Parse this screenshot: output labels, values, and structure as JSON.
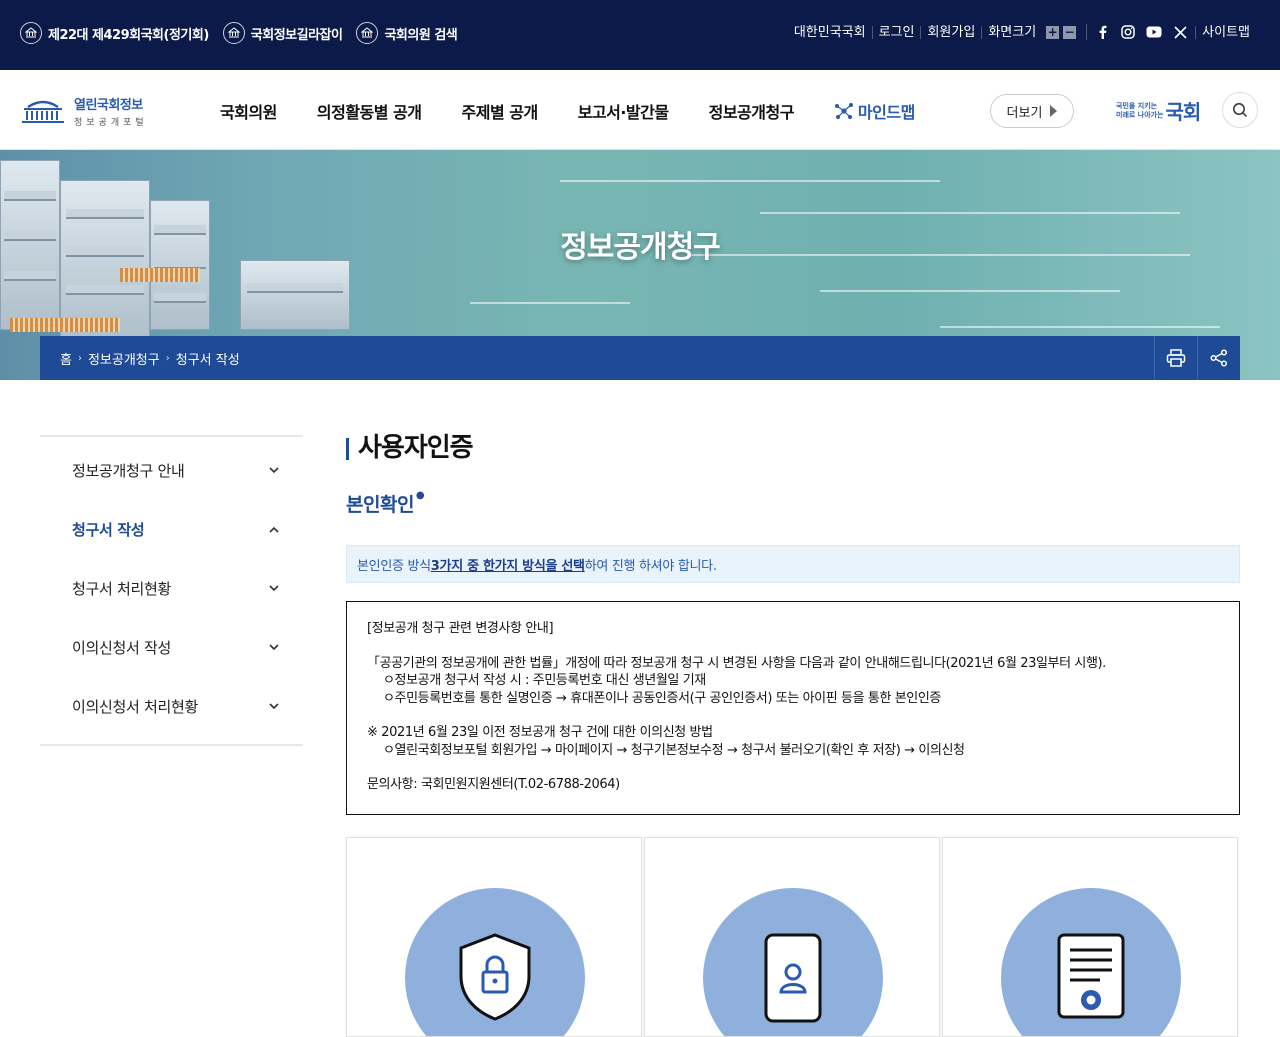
{
  "topbar": {
    "left_links": [
      "제22대 제429회국회(정기회)",
      "국회정보길라잡이",
      "국회의원 검색"
    ],
    "right_links": [
      "대한민국국회",
      "로그인",
      "회원가입",
      "화면크기"
    ],
    "zoom_in": "+",
    "zoom_out": "−",
    "sitemap": "사이트맵",
    "sns_icons": [
      "facebook-icon",
      "instagram-icon",
      "youtube-icon",
      "x-icon"
    ]
  },
  "header": {
    "logo_title": "열린국회정보",
    "logo_sub": "정보공개포털",
    "nav": [
      "국회의원",
      "의정활동별 공개",
      "주제별 공개",
      "보고서·발간물",
      "정보공개청구"
    ],
    "mindmap": "마인드맵",
    "more": "더보기",
    "slogan_small_1": "국민을 지키는",
    "slogan_small_2": "미래로 나아가는",
    "slogan_big": "국회"
  },
  "banner": {
    "title": "정보공개청구",
    "breadcrumb": [
      "홈",
      "정보공개청구",
      "청구서 작성"
    ]
  },
  "sidebar": {
    "items": [
      {
        "label": "정보공개청구 안내",
        "active": false
      },
      {
        "label": "청구서 작성",
        "active": true
      },
      {
        "label": "청구서 처리현황",
        "active": false
      },
      {
        "label": "이의신청서 작성",
        "active": false
      },
      {
        "label": "이의신청서 처리현황",
        "active": false
      }
    ]
  },
  "content": {
    "title": "사용자인증",
    "subtitle": "본인확인",
    "notice_pre": "본인인증 방식 ",
    "notice_emph": "3가지 중 한가지 방식을 선택",
    "notice_post": "하여 진행 하셔야 합니다.",
    "info": {
      "heading": "[정보공개 청구 관련 변경사항 안내]",
      "intro": "「공공기관의 정보공개에 관한 법률」개정에 따라 정보공개 청구 시 변경된 사항을 다음과 같이 안내해드립니다(2021년 6월 23일부터 시행).",
      "bullet1": "ㅇ정보공개 청구서 작성 시 : 주민등록번호 대신 생년월일 기재",
      "bullet2": "ㅇ주민등록번호를 통한 실명인증 → 휴대폰이나 공동인증서(구 공인인증서) 또는 아이핀 등을 통한 본인인증",
      "note": "※ 2021년 6월 23일 이전 정보공개 청구 건에 대한 이의신청 방법",
      "note_bullet": "ㅇ열린국회정보포털 회원가입 → 마이페이지 → 청구기본정보수정 → 청구서 불러오기(확인 후 저장) → 이의신청",
      "contact": "문의사항: 국회민원지원센터(T.02-6788-2064)"
    },
    "cards": [
      {
        "icon": "shield-lock-icon"
      },
      {
        "icon": "mobile-user-icon"
      },
      {
        "icon": "certificate-icon"
      }
    ]
  },
  "colors": {
    "topbar_bg": "#0c1a4a",
    "brand_blue": "#1f4a96",
    "accent_blue": "#2a5bb0",
    "card_circle": "#8fb0dc"
  }
}
